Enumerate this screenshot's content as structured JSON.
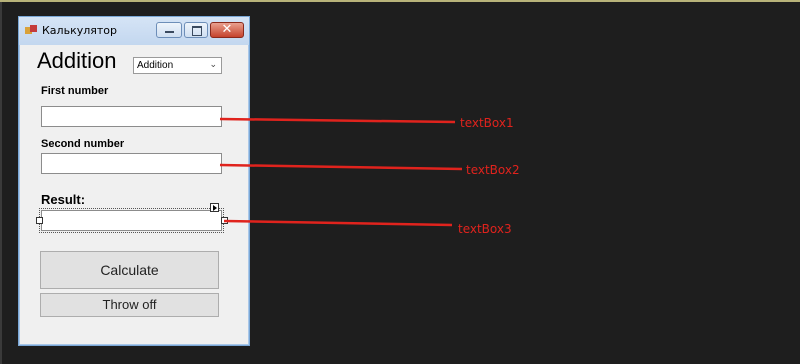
{
  "window": {
    "title": "Калькулятор",
    "heading": "Addition",
    "operation_combo": {
      "value": "Addition"
    }
  },
  "fields": {
    "first_label": "First number",
    "second_label": "Second number",
    "result_label": "Result:"
  },
  "buttons": {
    "calculate": "Calculate",
    "throw_off": "Throw off"
  },
  "annotations": {
    "textbox1": "textBox1",
    "textbox2": "textBox2",
    "textbox3": "textBox3",
    "color": "#e0231d"
  }
}
